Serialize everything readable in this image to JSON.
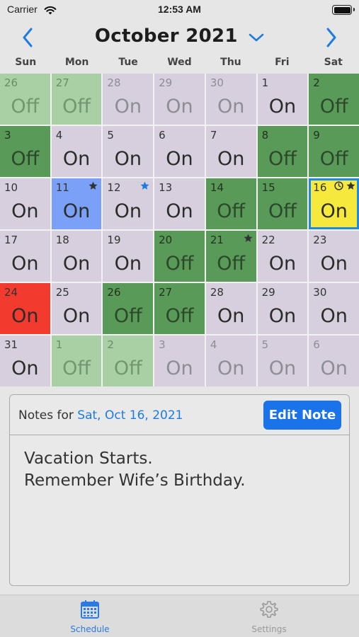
{
  "status_bar": {
    "carrier": "Carrier",
    "time": "12:53 AM"
  },
  "header": {
    "title": "October 2021"
  },
  "weekdays": [
    "Sun",
    "Mon",
    "Tue",
    "Wed",
    "Thu",
    "Fri",
    "Sat"
  ],
  "colors": {
    "off": "#5a9a59",
    "on": "#d7cfdd",
    "selected": "#f6e83c",
    "blue_day": "#7ba0f7",
    "red_day": "#f23a2e",
    "accent": "#1a73e8"
  },
  "days": [
    {
      "n": "26",
      "s": "Off",
      "out": true
    },
    {
      "n": "27",
      "s": "Off",
      "out": true
    },
    {
      "n": "28",
      "s": "On",
      "out": true
    },
    {
      "n": "29",
      "s": "On",
      "out": true
    },
    {
      "n": "30",
      "s": "On",
      "out": true
    },
    {
      "n": "1",
      "s": "On"
    },
    {
      "n": "2",
      "s": "Off"
    },
    {
      "n": "3",
      "s": "Off"
    },
    {
      "n": "4",
      "s": "On"
    },
    {
      "n": "5",
      "s": "On"
    },
    {
      "n": "6",
      "s": "On"
    },
    {
      "n": "7",
      "s": "On"
    },
    {
      "n": "8",
      "s": "Off"
    },
    {
      "n": "9",
      "s": "Off"
    },
    {
      "n": "10",
      "s": "On"
    },
    {
      "n": "11",
      "s": "On",
      "color": "blue",
      "marks": [
        "star-dark"
      ]
    },
    {
      "n": "12",
      "s": "On",
      "marks": [
        "star-blue"
      ]
    },
    {
      "n": "13",
      "s": "On"
    },
    {
      "n": "14",
      "s": "Off"
    },
    {
      "n": "15",
      "s": "Off"
    },
    {
      "n": "16",
      "s": "On",
      "color": "yellow",
      "marks": [
        "clock",
        "star-dark"
      ]
    },
    {
      "n": "17",
      "s": "On"
    },
    {
      "n": "18",
      "s": "On"
    },
    {
      "n": "19",
      "s": "On"
    },
    {
      "n": "20",
      "s": "Off"
    },
    {
      "n": "21",
      "s": "Off",
      "marks": [
        "star-dark"
      ]
    },
    {
      "n": "22",
      "s": "On"
    },
    {
      "n": "23",
      "s": "On"
    },
    {
      "n": "24",
      "s": "On",
      "color": "red"
    },
    {
      "n": "25",
      "s": "On"
    },
    {
      "n": "26",
      "s": "Off"
    },
    {
      "n": "27",
      "s": "Off"
    },
    {
      "n": "28",
      "s": "On"
    },
    {
      "n": "29",
      "s": "On"
    },
    {
      "n": "30",
      "s": "On"
    },
    {
      "n": "31",
      "s": "On"
    },
    {
      "n": "1",
      "s": "Off",
      "out": true
    },
    {
      "n": "2",
      "s": "Off",
      "out": true
    },
    {
      "n": "3",
      "s": "On",
      "out": true
    },
    {
      "n": "4",
      "s": "On",
      "out": true
    },
    {
      "n": "5",
      "s": "On",
      "out": true
    },
    {
      "n": "6",
      "s": "On",
      "out": true
    }
  ],
  "notes": {
    "label": "Notes for ",
    "date": "Sat, Oct 16, 2021",
    "edit_label": "Edit Note",
    "lines": [
      "Vacation Starts.",
      "Remember Wife’s Birthday."
    ]
  },
  "tabs": [
    {
      "label": "Schedule",
      "icon": "calendar-icon",
      "active": true
    },
    {
      "label": "Settings",
      "icon": "gear-icon",
      "active": false
    }
  ]
}
